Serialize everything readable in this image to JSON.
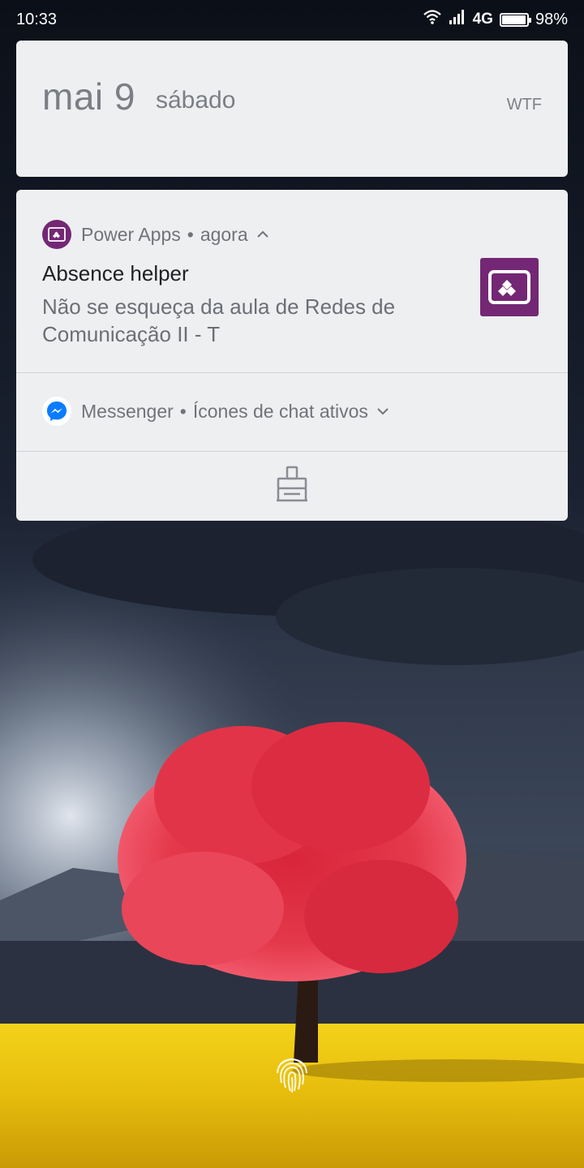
{
  "status_bar": {
    "time": "10:33",
    "network": "4G",
    "battery_percent": "98%",
    "battery_level": 0.98,
    "icons": [
      "wifi-icon",
      "signal-icon",
      "battery-icon"
    ]
  },
  "date_card": {
    "date": "mai 9",
    "weekday": "sábado",
    "location": "WTF"
  },
  "notifications": {
    "power_apps": {
      "app_name": "Power Apps",
      "separator": "•",
      "time": "agora",
      "title": "Absence helper",
      "body": "Não se esqueça da aula de Redes de Comunicação II - T",
      "icon": "power-apps-icon",
      "accent_color": "#742774"
    },
    "messenger": {
      "app_name": "Messenger",
      "separator": "•",
      "summary": "Ícones de chat ativos",
      "icon": "messenger-icon",
      "accent_color": "#0a7cff"
    }
  },
  "actions": {
    "clear_all_icon": "broom-clear-icon"
  },
  "lockscreen": {
    "fingerprint_icon": "fingerprint-icon"
  }
}
